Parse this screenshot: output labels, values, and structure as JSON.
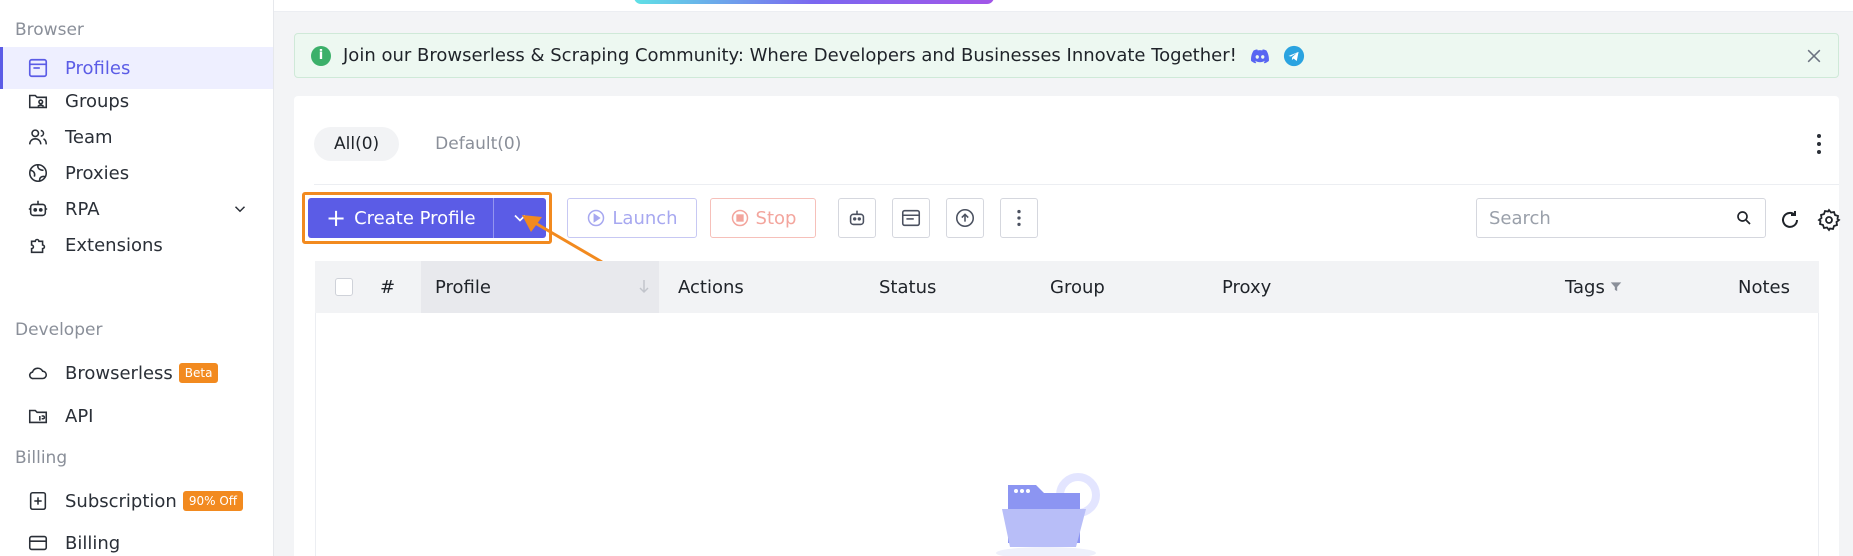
{
  "sidebar": {
    "sections": {
      "browser": "Browser",
      "developer": "Developer",
      "billing": "Billing"
    },
    "items": [
      {
        "label": "Profiles",
        "icon": "window-icon"
      },
      {
        "label": "Groups",
        "icon": "folder-user-icon"
      },
      {
        "label": "Team",
        "icon": "team-icon"
      },
      {
        "label": "Proxies",
        "icon": "globe-icon"
      },
      {
        "label": "RPA",
        "icon": "robot-icon"
      },
      {
        "label": "Extensions",
        "icon": "puzzle-icon"
      },
      {
        "label": "Browserless",
        "icon": "cloud-icon",
        "badge": "Beta"
      },
      {
        "label": "API",
        "icon": "api-icon"
      },
      {
        "label": "Subscription",
        "icon": "receipt-plus-icon",
        "badge": "90% Off"
      },
      {
        "label": "Billing",
        "icon": "billing-icon"
      }
    ]
  },
  "notice": {
    "text": "Join our Browserless & Scraping Community: Where Developers and Businesses Innovate Together!"
  },
  "tabs": [
    {
      "label": "All(0)"
    },
    {
      "label": "Default(0)"
    }
  ],
  "toolbar": {
    "create_label": "Create Profile",
    "launch_label": "Launch",
    "stop_label": "Stop",
    "search_placeholder": "Search"
  },
  "table": {
    "columns": [
      "#",
      "Profile",
      "Actions",
      "Status",
      "Group",
      "Proxy",
      "Tags",
      "Notes"
    ]
  },
  "colors": {
    "accent": "#5b5ce6",
    "highlight": "#f28a1f",
    "notice_bg": "#edf8f1"
  }
}
